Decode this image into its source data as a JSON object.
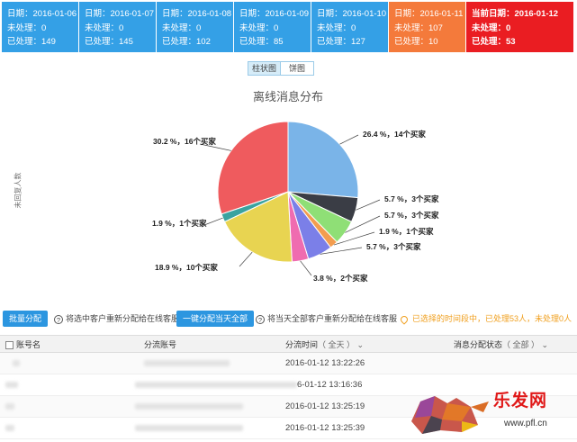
{
  "cards": [
    {
      "date": "日期：2016-01-06",
      "pending": "未处理：0",
      "processed": "已处理：149",
      "color": "blue"
    },
    {
      "date": "日期：2016-01-07",
      "pending": "未处理：0",
      "processed": "已处理：145",
      "color": "blue"
    },
    {
      "date": "日期：2016-01-08",
      "pending": "未处理：0",
      "processed": "已处理：102",
      "color": "blue"
    },
    {
      "date": "日期：2016-01-09",
      "pending": "未处理：0",
      "processed": "已处理：85",
      "color": "blue"
    },
    {
      "date": "日期：2016-01-10",
      "pending": "未处理：0",
      "processed": "已处理：127",
      "color": "blue"
    },
    {
      "date": "日期：2016-01-11",
      "pending": "未处理：107",
      "processed": "已处理：10",
      "color": "orange"
    },
    {
      "date": "当前日期：2016-01-12",
      "pending": "未处理：0",
      "processed": "已处理：53",
      "color": "red"
    }
  ],
  "chart_toggle": {
    "bar_label": "柱状图",
    "pie_label": "饼图",
    "active": "pie"
  },
  "chart_data": {
    "type": "pie",
    "title": "离线消息分布",
    "ylabel": "未回复人数",
    "slices": [
      {
        "label": "26.4 %，14个买家",
        "value": 26.4,
        "color": "#7ab4e8"
      },
      {
        "label": "5.7 %，3个买家",
        "value": 5.7,
        "color": "#3a3d45"
      },
      {
        "label": "5.7 %，3个买家",
        "value": 5.7,
        "color": "#8fdf76"
      },
      {
        "label": "1.9 %，1个买家",
        "value": 1.9,
        "color": "#f39d4f"
      },
      {
        "label": "5.7 %，3个买家",
        "value": 5.7,
        "color": "#7b7fe8"
      },
      {
        "label": "3.8 %，2个买家",
        "value": 3.8,
        "color": "#ef6cb0"
      },
      {
        "label": "18.9 %，10个买家",
        "value": 18.9,
        "color": "#e8d451"
      },
      {
        "label": "1.9 %，1个买家",
        "value": 1.9,
        "color": "#3aa3a0"
      },
      {
        "label": "30.2 %，16个买家",
        "value": 30.2,
        "color": "#ef5b5e"
      }
    ]
  },
  "actions": {
    "batch_assign": "批量分配",
    "batch_hint": "将选中客户重新分配给在线客服",
    "assign_today": "一键分配当天全部",
    "today_hint": "将当天全部客户重新分配给在线客服",
    "status_note": "已选择的时间段中，已处理53人，未处理0人"
  },
  "table": {
    "headers": {
      "account": "账号名",
      "shunt": "分流账号",
      "time": "分流时间",
      "time_filter": "（ 全天 ）",
      "status": "消息分配状态",
      "status_filter": "（ 全部 ）"
    },
    "rows": [
      {
        "time": "2016-01-12 13:22:26"
      },
      {
        "time": "6-01-12 13:16:36"
      },
      {
        "time": "2016-01-12 13:25:19"
      },
      {
        "time": "2016-01-12 13:25:39"
      }
    ]
  },
  "watermark": {
    "text": "乐发网",
    "url": "www.pfl.cn"
  }
}
